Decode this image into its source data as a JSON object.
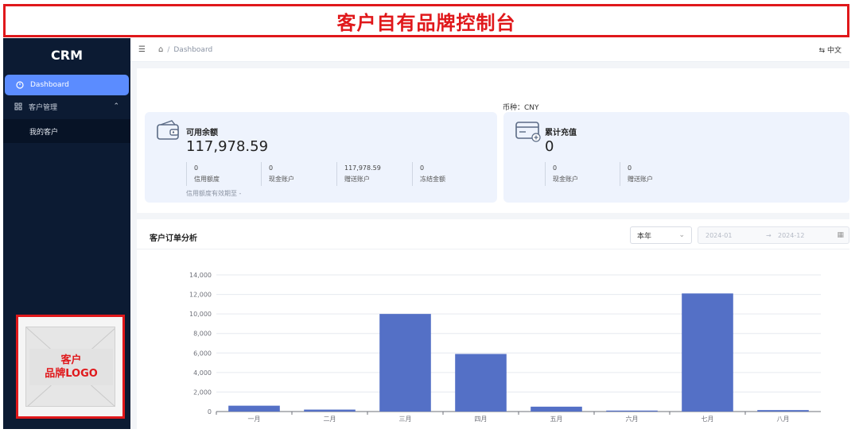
{
  "banner": {
    "title": "客户自有品牌控制台"
  },
  "sidebar": {
    "logo": "CRM",
    "items": [
      {
        "label": "Dashboard",
        "icon": "dashboard-icon",
        "active": true
      },
      {
        "label": "客户管理",
        "icon": "grid-icon",
        "expanded": true
      }
    ],
    "subitems": [
      {
        "label": "我的客户"
      }
    ],
    "brand_placeholder": {
      "line1": "客户",
      "line2": "品牌LOGO"
    }
  },
  "topbar": {
    "breadcrumb": [
      "Dashboard"
    ],
    "language": "中文"
  },
  "overview": {
    "currency": "币种：CNY",
    "balance_card": {
      "title": "可用余额",
      "amount": "117,978.59",
      "stats": [
        {
          "value": "0",
          "label": "信用额度"
        },
        {
          "value": "0",
          "label": "现金账户"
        },
        {
          "value": "117,978.59",
          "label": "赠送账户"
        },
        {
          "value": "0",
          "label": "冻结金额"
        }
      ],
      "note": "信用额度有效期至 -"
    },
    "recharge_card": {
      "title": "累计充值",
      "amount": "0",
      "stats": [
        {
          "value": "0",
          "label": "现金账户"
        },
        {
          "value": "0",
          "label": "赠送账户"
        }
      ]
    }
  },
  "order_analysis": {
    "title": "客户订单分析",
    "period_select": "本年",
    "range_start": "2024-01",
    "range_arrow": "→",
    "range_end": "2024-12"
  },
  "chart_data": {
    "type": "bar",
    "categories": [
      "一月",
      "二月",
      "三月",
      "四月",
      "五月",
      "六月",
      "七月",
      "八月"
    ],
    "values": [
      600,
      200,
      10000,
      5900,
      500,
      100,
      12100,
      150
    ],
    "ylim": [
      0,
      14000
    ],
    "yticks": [
      0,
      2000,
      4000,
      6000,
      8000,
      10000,
      12000,
      14000
    ],
    "ytick_labels": [
      "0",
      "2,000",
      "4,000",
      "6,000",
      "8,000",
      "10,000",
      "12,000",
      "14,000"
    ],
    "grid": true,
    "bar_color": "#5470c6"
  }
}
